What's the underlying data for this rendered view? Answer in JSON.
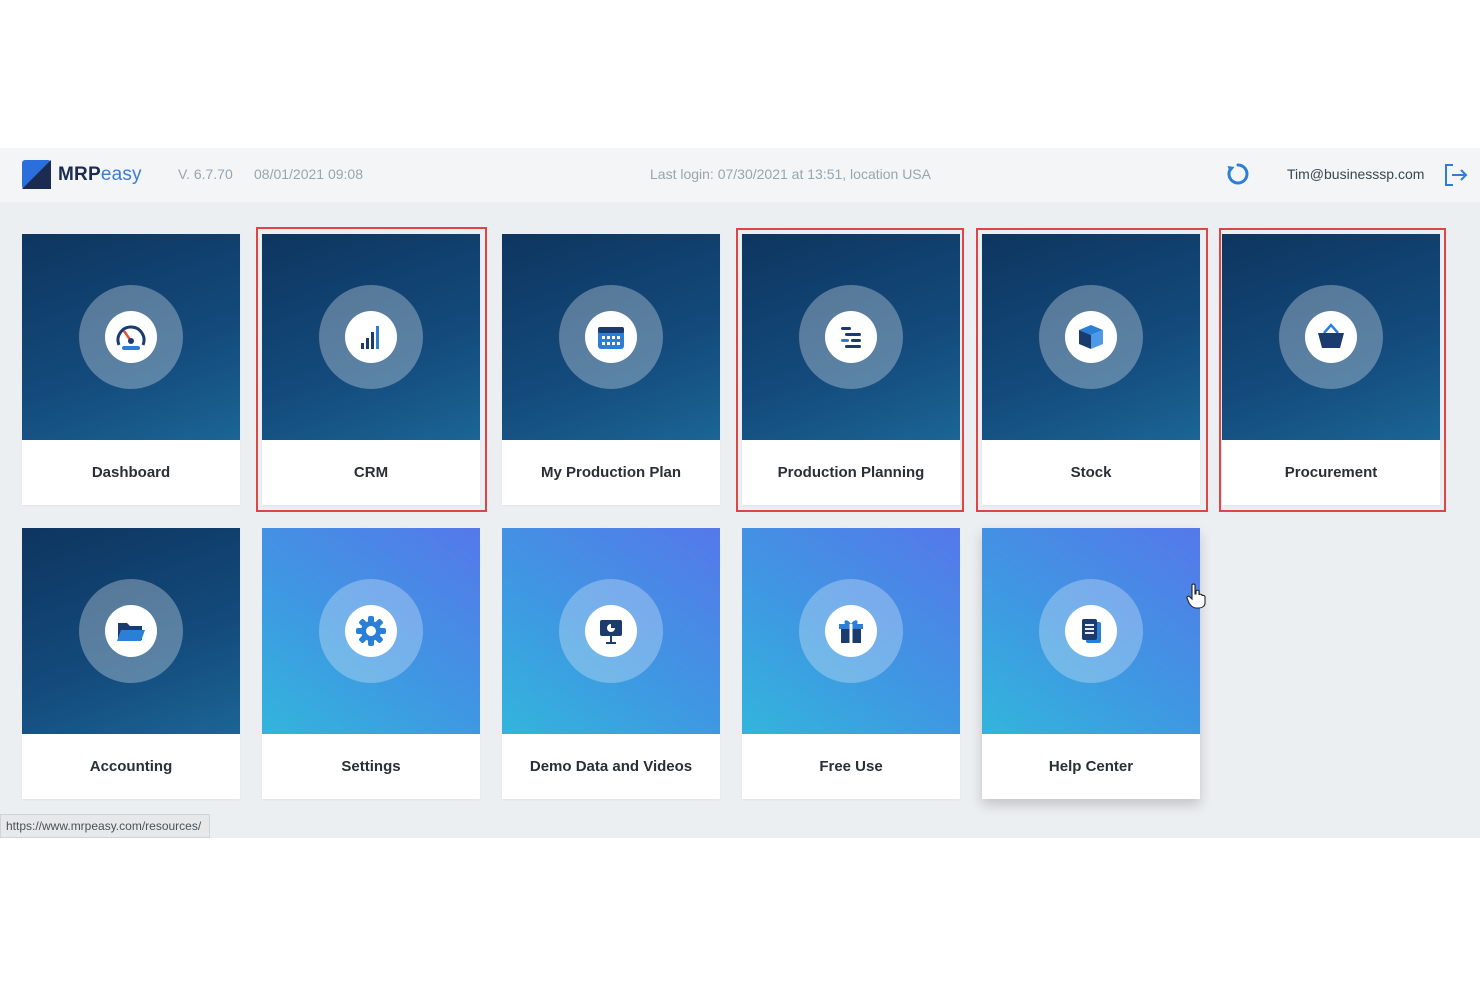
{
  "header": {
    "logo_bold": "MRP",
    "logo_light": "easy",
    "version": "V. 6.7.70",
    "datetime": "08/01/2021 09:08",
    "last_login": "Last login: 07/30/2021 at 13:51, location USA",
    "user_email": "Tim@businesssp.com",
    "refresh_icon": "refresh-icon",
    "logout_icon": "logout-icon"
  },
  "tiles": [
    {
      "label": "Dashboard",
      "icon": "speedometer-icon",
      "style": "dark",
      "highlighted": false
    },
    {
      "label": "CRM",
      "icon": "bar-chart-icon",
      "style": "dark",
      "highlighted": true
    },
    {
      "label": "My Production Plan",
      "icon": "calendar-icon",
      "style": "dark",
      "highlighted": false
    },
    {
      "label": "Production Planning",
      "icon": "gantt-icon",
      "style": "dark",
      "highlighted": true
    },
    {
      "label": "Stock",
      "icon": "box-icon",
      "style": "dark",
      "highlighted": true
    },
    {
      "label": "Procurement",
      "icon": "basket-icon",
      "style": "dark",
      "highlighted": true
    },
    {
      "label": "Accounting",
      "icon": "folder-icon",
      "style": "dark",
      "highlighted": false
    },
    {
      "label": "Settings",
      "icon": "gear-icon",
      "style": "light",
      "highlighted": false
    },
    {
      "label": "Demo Data and Videos",
      "icon": "presentation-icon",
      "style": "light",
      "highlighted": false
    },
    {
      "label": "Free Use",
      "icon": "gift-icon",
      "style": "light",
      "highlighted": false
    },
    {
      "label": "Help Center",
      "icon": "document-icon",
      "style": "light",
      "highlighted": false
    }
  ],
  "status_url": "https://www.mrpeasy.com/resources/",
  "colors": {
    "highlight": "#e04545",
    "dark_tile": "#134b7c",
    "light_tile": "#3f97e2",
    "brand": "#1c2c50"
  }
}
